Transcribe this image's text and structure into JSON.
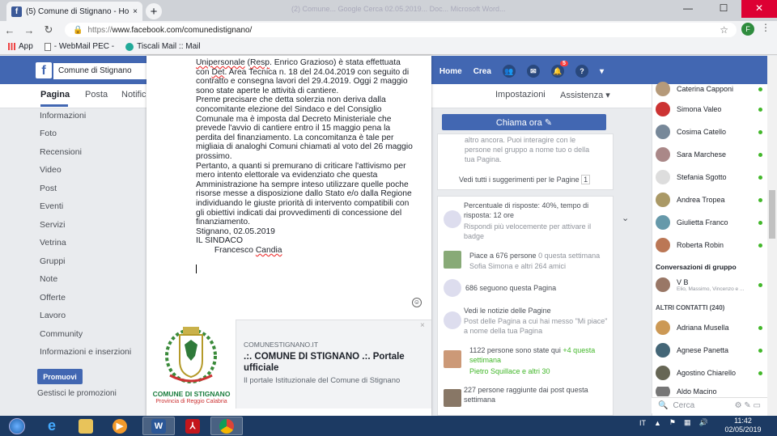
{
  "browser": {
    "tab_title": "(5) Comune di Stignano - Home",
    "tab_close": "×",
    "new_tab": "+",
    "ghost_title": "(2) Comune... Google Cerca 02.05.2019... Doc... Microsoft Word...",
    "url_scheme": "https://",
    "url_host": "www.facebook.com/comunedistignano/",
    "profile_initial": "F",
    "win_min": "—",
    "win_max": "☐",
    "win_close": "✕"
  },
  "bookmarks": [
    {
      "label": "App"
    },
    {
      "label": "- WebMail PEC -"
    },
    {
      "label": "Tiscali Mail :: Mail"
    }
  ],
  "fb": {
    "search_value": "Comune di Stignano",
    "nav_home": "Home",
    "nav_create": "Crea",
    "nav_partial": "lo",
    "notif_count": "5"
  },
  "page_tabs": {
    "pagina": "Pagina",
    "posta": "Posta",
    "notifiche": "Notific",
    "impostazioni": "Impostazioni",
    "assistenza": "Assistenza ▾"
  },
  "left_nav": [
    "Informazioni",
    "Foto",
    "Recensioni",
    "Video",
    "Post",
    "Eventi",
    "Servizi",
    "Vetrina",
    "Gruppi",
    "Note",
    "Offerte",
    "Lavoro",
    "Community",
    "Informazioni e inserzioni"
  ],
  "promo_button": "Promuovi",
  "manage_promos": "Gestisci le promozioni",
  "post": {
    "lines": [
      [
        "Unipersonale",
        " (",
        "Resp",
        ".",
        " Enrico Grazioso) è stata effettuata"
      ],
      [
        "con ",
        "Det",
        ". Area Tecnica n. 18 del 24.04.2019 con seguito di"
      ],
      [
        "contratto e consegna lavori del 29.4.2019. Oggi 2 maggio"
      ],
      [
        "sono state aperte le attività di cantiere."
      ],
      [
        "Preme precisare che detta solerzia non deriva dalla"
      ],
      [
        "concomitante elezione del Sindaco e del Consiglio"
      ],
      [
        "Comunale ma è imposta dal Decreto Ministeriale che"
      ],
      [
        "prevede l'avvio di cantiere entro il 15 maggio pena la"
      ],
      [
        "perdita del finanziamento. La concomitanza è tale per"
      ],
      [
        "migliaia di analoghi Comuni chiamati al voto del 26 maggio"
      ],
      [
        "prossimo."
      ],
      [
        "Pertanto, a quanti si premurano di criticare l'attivismo per"
      ],
      [
        "mero intento elettorale va evidenziato che questa"
      ],
      [
        "Amministrazione ha sempre inteso utilizzare quelle poche"
      ],
      [
        "risorse messe a disposizione dallo Stato e/o dalla Regione"
      ],
      [
        "individuando le giuste priorità di intervento compatibili con"
      ],
      [
        "gli obiettivi indicati dai provvedimenti di concessione del"
      ],
      [
        "finanziamento."
      ],
      [
        "Stignano, 02.05.2019"
      ],
      [
        "IL SINDACO"
      ],
      [
        "        Francesco ",
        "Candia"
      ]
    ]
  },
  "link_preview": {
    "domain": "COMUNESTIGNANO.IT",
    "title": ".:. COMUNE DI STIGNANO .:. Portale ufficiale",
    "description": "Il portale Istituzionale del Comune di Stignano",
    "logo_name": "COMUNE DI STIGNANO",
    "logo_sub": "Provincia di Reggio Calabria",
    "close": "×"
  },
  "right": {
    "call_button": "Chiama ora ✎",
    "invite_1": "altro ancora. Puoi interagire con le",
    "invite_2": "persone nel gruppo a nome tuo o della",
    "invite_3": "tua Pagina.",
    "suggestions": "Vedi tutti i suggerimenti per le Pagine",
    "suggestions_count": "1",
    "response_1": "Percentuale di risposte: 40%, tempo di",
    "response_2": "risposta: 12 ore",
    "response_3": "Rispondi più velocemente per attivare il",
    "response_4": "badge",
    "likes_1": "Piace a 676 persone",
    "likes_1b": " 0 questa settimana",
    "likes_2": "Sofia Simona e altri 264 amici",
    "follow": "686 seguono questa Pagina",
    "liked_1": "Vedi le notizie delle Pagine",
    "liked_2": "Post delle Pagina a cui hai messo \"Mi piace\"",
    "liked_3": "a nome della tua Pagina",
    "visits_1": "1122 persone sono state qui",
    "visits_1b": " +4 questa",
    "visits_2": "settimana",
    "visits_3": "Pietro Squillace e altri 30",
    "reach_1": "227 persone raggiunte dai post questa",
    "reach_2": "settimana"
  },
  "chat": {
    "contacts_top": [
      "Caterina Capponi",
      "Simona Valeo",
      "Cosima Catello",
      "Sara Marchese",
      "Stefania Sgotto",
      "Andrea Tropea",
      "Giulietta Franco",
      "Roberta Robin"
    ],
    "group_header": "Conversazioni di gruppo",
    "group_name": "V B",
    "group_members": "Elio, Massimo, Vincenzo e ...",
    "other_header": "ALTRI CONTATTI (240)",
    "contacts_other": [
      "Adriana Musella",
      "Agnese Panetta",
      "Agostino Chiarello",
      "Aldo Macino"
    ],
    "search": "Cerca"
  },
  "taskbar": {
    "lang": "IT",
    "time": "11:42",
    "date": "02/05/2019"
  },
  "colors": {
    "fb_blue": "#4267b2",
    "green": "#42b72a",
    "taskbar": "#1c3a63"
  }
}
